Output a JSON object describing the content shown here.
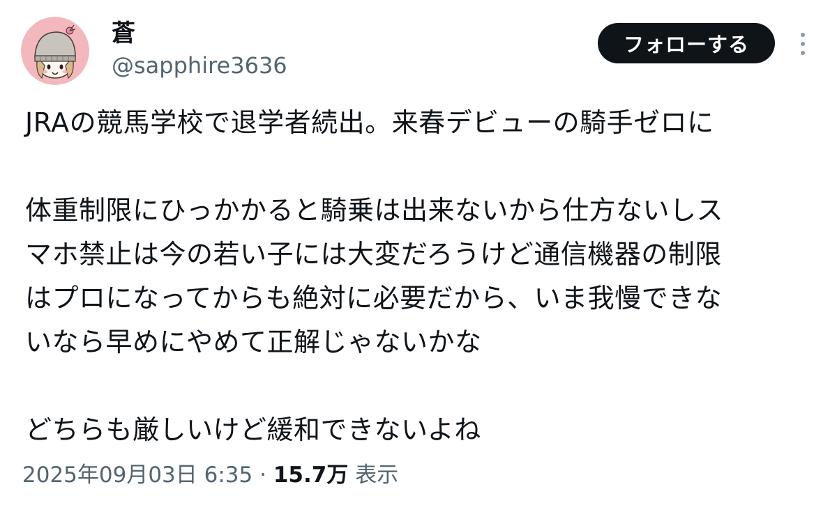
{
  "author": {
    "display_name": "蒼",
    "handle": "@sapphire3636",
    "avatar_icon": "avatar-knit-hat-girl-icon"
  },
  "actions": {
    "follow_label": "フォローする",
    "more_icon": "more-vertical-icon"
  },
  "tweet": {
    "lines": [
      "JRAの競馬学校で退学者続出。来春デビューの騎手ゼロに",
      "",
      "体重制限にひっかかると騎乗は出来ないから仕方ないしス",
      "マホ禁止は今の若い子には大変だろうけど通信機器の制限",
      "はプロになってからも絶対に必要だから、いま我慢できな",
      "いなら早めにやめて正解じゃないかな",
      "",
      "どちらも厳しいけど緩和できないよね"
    ]
  },
  "meta": {
    "timestamp": "2025年09月03日 6:35",
    "separator": "·",
    "views_count": "15.7万",
    "views_label": "表示"
  },
  "colors": {
    "text_primary": "#0f1419",
    "text_secondary": "#536471",
    "follow_bg": "#0f1419",
    "avatar_bg": "#f2b8bd"
  }
}
